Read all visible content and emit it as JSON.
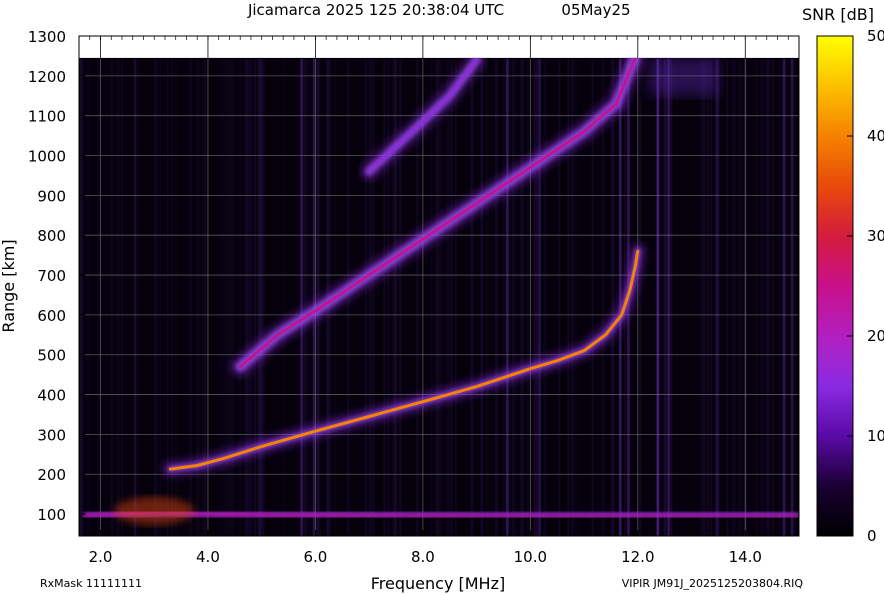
{
  "chart_data": {
    "type": "heatmap",
    "title": "Jicamarca 2025 125 20:38:04 UTC",
    "date_label": "05May25",
    "xlabel": "Frequency [MHz]",
    "ylabel": "Range [km]",
    "colorbar_label": "SNR [dB]",
    "xlim": [
      1.6,
      15.0
    ],
    "ylim": [
      45,
      1300
    ],
    "data_top_km": 1245,
    "x_ticks": [
      2.0,
      4.0,
      6.0,
      8.0,
      10.0,
      12.0,
      14.0
    ],
    "x_tick_labels": [
      "2.0",
      "4.0",
      "6.0",
      "8.0",
      "10.0",
      "12.0",
      "14.0"
    ],
    "y_ticks": [
      100,
      200,
      300,
      400,
      500,
      600,
      700,
      800,
      900,
      1000,
      1100,
      1200,
      1300
    ],
    "y_tick_labels": [
      "100",
      "200",
      "300",
      "400",
      "500",
      "600",
      "700",
      "800",
      "900",
      "1000",
      "1100",
      "1200",
      "1300"
    ],
    "colorbar_range": [
      0,
      50
    ],
    "colorbar_ticks": [
      0,
      10,
      20,
      30,
      40,
      50
    ],
    "colorbar_tick_labels": [
      "0",
      "10",
      "20",
      "30",
      "40",
      "50"
    ],
    "grid": true,
    "traces": [
      {
        "name": "",
        "points": [
          [
            3.3,
            213
          ],
          [
            3.8,
            222
          ],
          [
            4.3,
            240
          ],
          [
            5.0,
            270
          ],
          [
            6.0,
            308
          ],
          [
            7.0,
            345
          ],
          [
            8.0,
            382
          ],
          [
            9.0,
            420
          ],
          [
            10.0,
            465
          ],
          [
            10.5,
            485
          ],
          [
            11.0,
            510
          ],
          [
            11.4,
            550
          ],
          [
            11.7,
            600
          ],
          [
            11.85,
            660
          ],
          [
            11.95,
            720
          ],
          [
            12.0,
            760
          ]
        ],
        "snr_db": 40
      },
      {
        "name": "",
        "points": [
          [
            4.6,
            470
          ],
          [
            5.3,
            550
          ],
          [
            6.0,
            610
          ],
          [
            7.0,
            700
          ],
          [
            8.0,
            790
          ],
          [
            9.0,
            880
          ],
          [
            10.0,
            970
          ],
          [
            11.0,
            1060
          ],
          [
            11.6,
            1130
          ],
          [
            11.95,
            1245
          ]
        ],
        "snr_db": 25
      },
      {
        "name": "",
        "points": [
          [
            7.0,
            960
          ],
          [
            7.8,
            1060
          ],
          [
            8.5,
            1150
          ],
          [
            9.0,
            1240
          ]
        ],
        "snr_db": 15
      },
      {
        "name": "",
        "points": [
          [
            1.7,
            95
          ],
          [
            2.5,
            100
          ],
          [
            3.2,
            105
          ],
          [
            4.0,
            100
          ],
          [
            5.0,
            97
          ],
          [
            7.0,
            95
          ],
          [
            10.0,
            93
          ],
          [
            15.0,
            93
          ]
        ],
        "snr_db": 22
      }
    ]
  },
  "footer": {
    "rxmask": "RxMask 11111111",
    "file": "VIPIR  JM91J_2025125203804.RIQ"
  }
}
